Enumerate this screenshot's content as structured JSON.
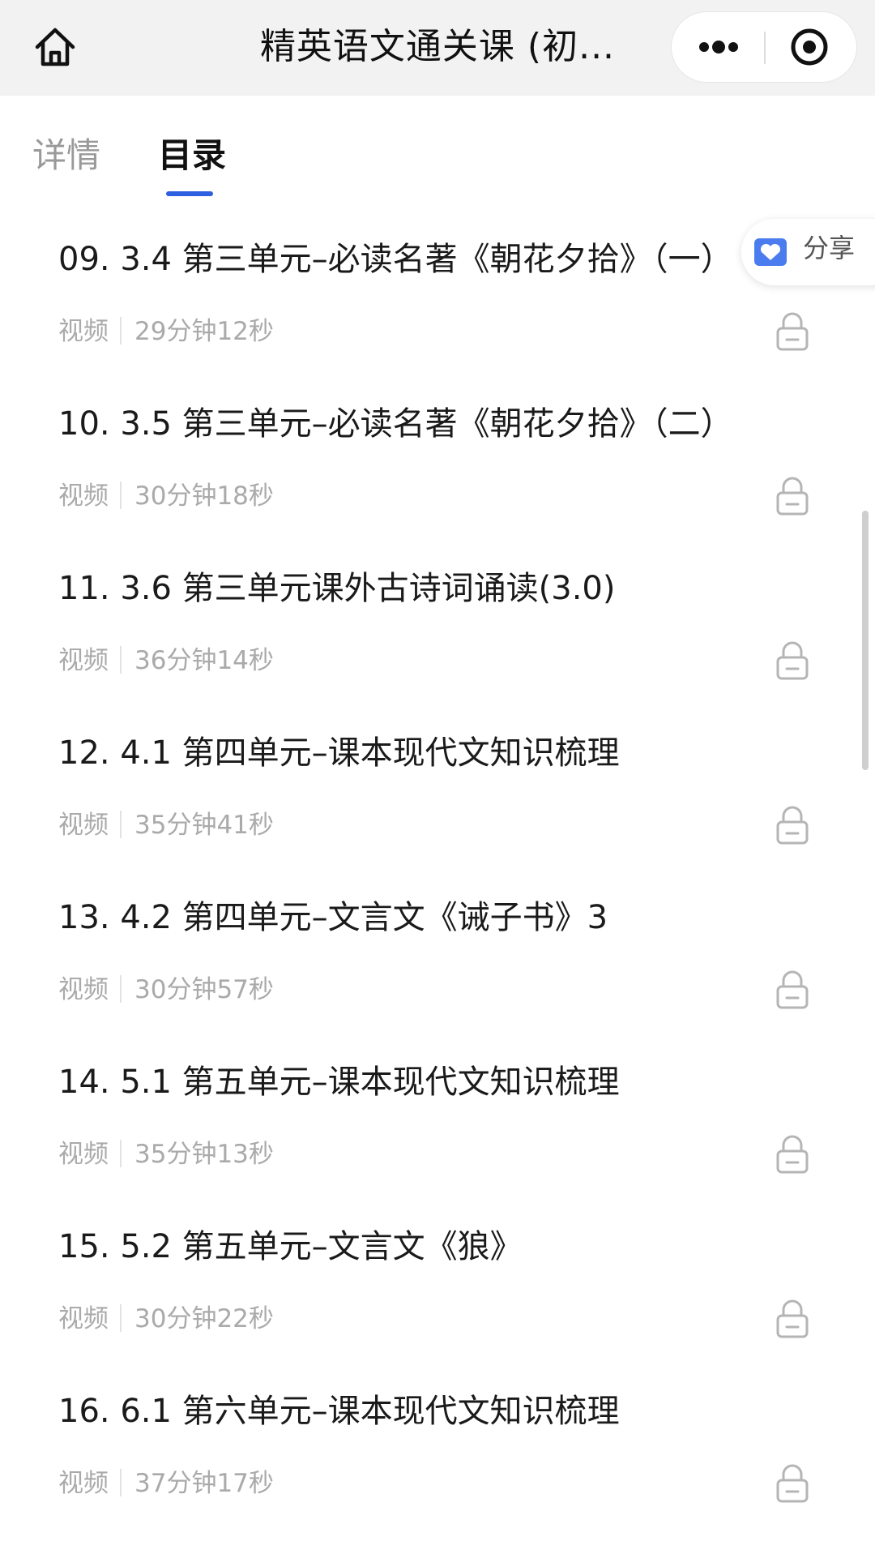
{
  "topbar": {
    "title": "精英语文通关课 (初...",
    "home_icon": "home-icon",
    "more_icon": "more-dots-icon",
    "close_icon": "target-close-icon"
  },
  "tabs": {
    "detail": "详情",
    "catalog": "目录",
    "active": "catalog",
    "accent_color": "#2e5fe0"
  },
  "share": {
    "label": "分享",
    "icon": "share-heart-icon",
    "icon_color": "#4a7cf0"
  },
  "lessons": [
    {
      "title": "09. 3.4 第三单元–必读名著《朝花夕拾》（一）",
      "type": "视频",
      "duration": "29分钟12秒",
      "locked": true
    },
    {
      "title": "10. 3.5 第三单元–必读名著《朝花夕拾》（二）",
      "type": "视频",
      "duration": "30分钟18秒",
      "locked": true
    },
    {
      "title": "11. 3.6 第三单元课外古诗词诵读(3.0)",
      "type": "视频",
      "duration": "36分钟14秒",
      "locked": true
    },
    {
      "title": "12. 4.1 第四单元–课本现代文知识梳理",
      "type": "视频",
      "duration": "35分钟41秒",
      "locked": true
    },
    {
      "title": "13. 4.2 第四单元–文言文《诫子书》3",
      "type": "视频",
      "duration": "30分钟57秒",
      "locked": true
    },
    {
      "title": "14. 5.1 第五单元–课本现代文知识梳理",
      "type": "视频",
      "duration": "35分钟13秒",
      "locked": true
    },
    {
      "title": "15. 5.2 第五单元–文言文《狼》",
      "type": "视频",
      "duration": "30分钟22秒",
      "locked": true
    },
    {
      "title": "16. 6.1 第六单元–课本现代文知识梳理",
      "type": "视频",
      "duration": "37分钟17秒",
      "locked": true
    }
  ]
}
